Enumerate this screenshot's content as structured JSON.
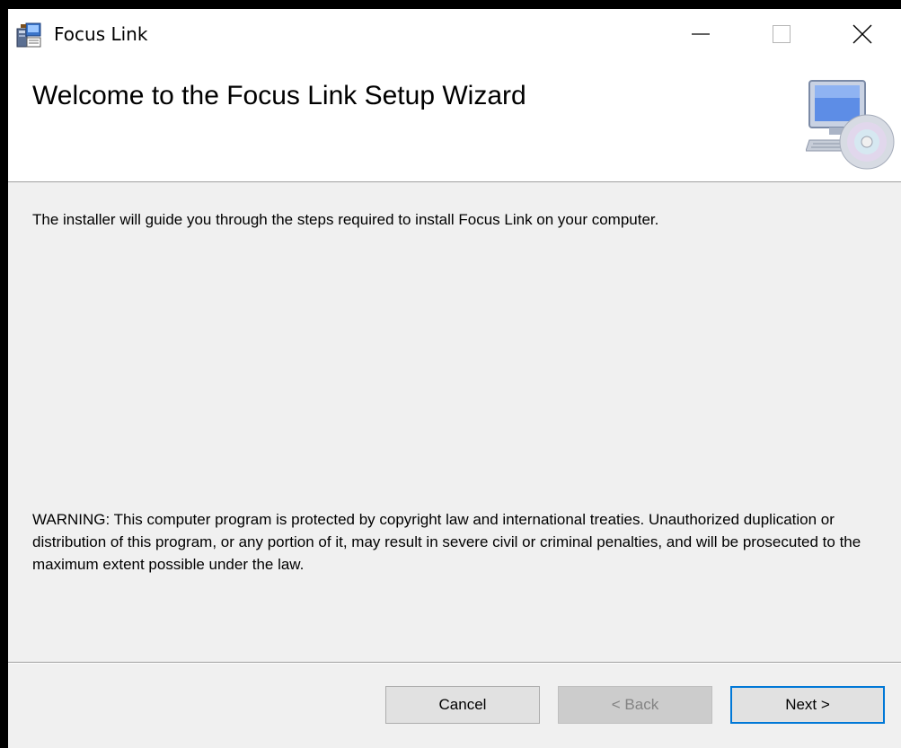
{
  "window": {
    "title": "Focus Link",
    "controls": {
      "minimize_icon": "minimize-icon",
      "maximize_icon": "maximize-icon",
      "close_icon": "close-icon"
    }
  },
  "header": {
    "title": "Welcome to the Focus Link Setup Wizard",
    "icon": "computer-cd-icon"
  },
  "body": {
    "intro": "The installer will guide you through the steps required to install Focus Link on your computer.",
    "warning": "WARNING: This computer program is protected by copyright law and international treaties. Unauthorized duplication or distribution of this program, or any portion of it, may result in severe civil or criminal penalties, and will be prosecuted to the maximum extent possible under the law."
  },
  "buttons": {
    "cancel": "Cancel",
    "back": "< Back",
    "next": "Next >"
  },
  "colors": {
    "window_background": "#f0f0f0",
    "header_background": "#ffffff",
    "focus_border": "#0078d7",
    "disabled_text": "#838383"
  }
}
